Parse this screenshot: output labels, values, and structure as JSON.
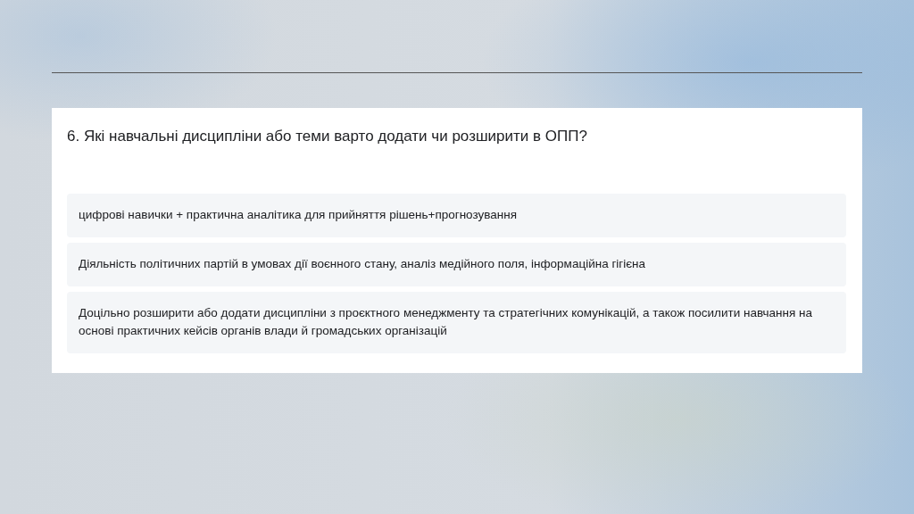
{
  "question": {
    "title": "6. Які навчальні дисципліни або теми варто додати чи розширити в ОПП?",
    "responses": [
      "цифрові навички + практична аналітика для прийняття рішень+прогнозування",
      "Діяльність політичних партій в умовах дії воєнного стану, аналіз медійного поля, інформаційна гігієна",
      "Доцільно розширити або додати дисципліни з проєктного менеджменту та стратегічних комунікацій, а також посилити навчання на основі практичних кейсів органів влади й громадських організацій"
    ]
  }
}
